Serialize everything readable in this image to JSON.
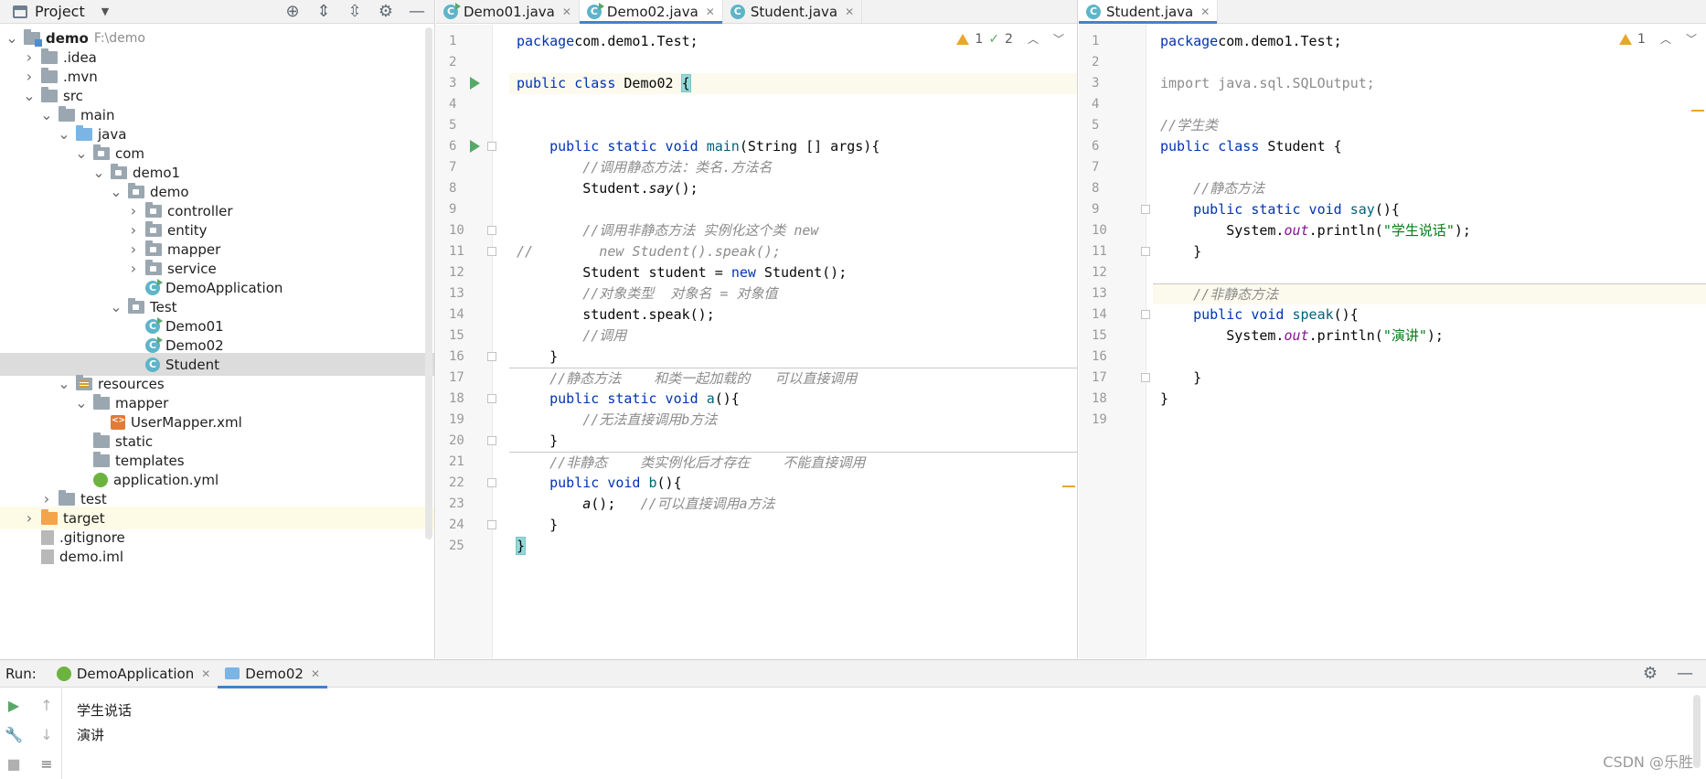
{
  "project": {
    "title": "Project",
    "tree": [
      {
        "label": "demo",
        "path": "F:\\demo",
        "depth": 0,
        "arrow": "v",
        "icon": "module-folder-icon",
        "bold": true
      },
      {
        "label": ".idea",
        "depth": 1,
        "arrow": ">",
        "icon": "folder-icon"
      },
      {
        "label": ".mvn",
        "depth": 1,
        "arrow": ">",
        "icon": "folder-icon"
      },
      {
        "label": "src",
        "depth": 1,
        "arrow": "v",
        "icon": "folder-icon"
      },
      {
        "label": "main",
        "depth": 2,
        "arrow": "v",
        "icon": "folder-icon"
      },
      {
        "label": "java",
        "depth": 3,
        "arrow": "v",
        "icon": "source-folder-icon"
      },
      {
        "label": "com",
        "depth": 4,
        "arrow": "v",
        "icon": "package-icon"
      },
      {
        "label": "demo1",
        "depth": 5,
        "arrow": "v",
        "icon": "package-icon"
      },
      {
        "label": "demo",
        "depth": 6,
        "arrow": "v",
        "icon": "package-icon"
      },
      {
        "label": "controller",
        "depth": 7,
        "arrow": ">",
        "icon": "package-icon"
      },
      {
        "label": "entity",
        "depth": 7,
        "arrow": ">",
        "icon": "package-icon"
      },
      {
        "label": "mapper",
        "depth": 7,
        "arrow": ">",
        "icon": "package-icon"
      },
      {
        "label": "service",
        "depth": 7,
        "arrow": ">",
        "icon": "package-icon"
      },
      {
        "label": "DemoApplication",
        "depth": 7,
        "arrow": "",
        "icon": "runnable-class-icon"
      },
      {
        "label": "Test",
        "depth": 6,
        "arrow": "v",
        "icon": "package-icon"
      },
      {
        "label": "Demo01",
        "depth": 7,
        "arrow": "",
        "icon": "runnable-class-icon"
      },
      {
        "label": "Demo02",
        "depth": 7,
        "arrow": "",
        "icon": "runnable-class-icon"
      },
      {
        "label": "Student",
        "depth": 7,
        "arrow": "",
        "icon": "class-icon",
        "selected": true
      },
      {
        "label": "resources",
        "depth": 3,
        "arrow": "v",
        "icon": "resources-folder-icon"
      },
      {
        "label": "mapper",
        "depth": 4,
        "arrow": "v",
        "icon": "folder-icon"
      },
      {
        "label": "UserMapper.xml",
        "depth": 5,
        "arrow": "",
        "icon": "xml-file-icon"
      },
      {
        "label": "static",
        "depth": 4,
        "arrow": "",
        "icon": "folder-icon"
      },
      {
        "label": "templates",
        "depth": 4,
        "arrow": "",
        "icon": "folder-icon"
      },
      {
        "label": "application.yml",
        "depth": 4,
        "arrow": "",
        "icon": "yml-file-icon"
      },
      {
        "label": "test",
        "depth": 2,
        "arrow": ">",
        "icon": "folder-icon"
      },
      {
        "label": "target",
        "depth": 1,
        "arrow": ">",
        "icon": "excluded-folder-icon",
        "highlight": true
      },
      {
        "label": ".gitignore",
        "depth": 1,
        "arrow": "",
        "icon": "file-icon"
      },
      {
        "label": "demo.iml",
        "depth": 1,
        "arrow": "",
        "icon": "file-icon"
      }
    ]
  },
  "left_editor": {
    "tabs": [
      {
        "label": "Demo01.java",
        "icon": "runnable-class-icon",
        "active": false
      },
      {
        "label": "Demo02.java",
        "icon": "runnable-class-icon",
        "active": true
      },
      {
        "label": "Student.java",
        "icon": "class-icon",
        "active": false
      }
    ],
    "inspections": {
      "warnings": "1",
      "checks": "2"
    },
    "lines": [
      [
        [
          "kw",
          "package"
        ],
        [
          "",
          "com.demo1.Test;"
        ]
      ],
      [],
      [
        [
          "kw",
          "public class"
        ],
        [
          "",
          " Demo02 "
        ],
        [
          "brace",
          "{"
        ]
      ],
      [],
      [],
      [
        [
          "",
          "    "
        ],
        [
          "kw",
          "public static void"
        ],
        [
          "",
          " "
        ],
        [
          "fn",
          "main"
        ],
        [
          "",
          "(String [] args){"
        ]
      ],
      [
        [
          "",
          "        "
        ],
        [
          "cm",
          "//调用静态方法：类名.方法名"
        ]
      ],
      [
        [
          "",
          "        Student."
        ],
        [
          "st",
          "say"
        ],
        [
          "",
          "();"
        ]
      ],
      [],
      [
        [
          "",
          "        "
        ],
        [
          "cm",
          "//调用非静态方法 实例化这个类 new"
        ]
      ],
      [
        [
          "cm",
          "//        new Student().speak();"
        ]
      ],
      [
        [
          "",
          "        Student student = "
        ],
        [
          "kw",
          "new"
        ],
        [
          "",
          " Student();"
        ]
      ],
      [
        [
          "",
          "        "
        ],
        [
          "cm",
          "//对象类型  对象名 = 对象值"
        ]
      ],
      [
        [
          "",
          "        student.speak();"
        ]
      ],
      [
        [
          "",
          "        "
        ],
        [
          "cm",
          "//调用"
        ]
      ],
      [
        [
          "",
          "    }"
        ]
      ],
      [
        [
          "",
          "    "
        ],
        [
          "cm",
          "//静态方法    和类一起加载的   可以直接调用"
        ]
      ],
      [
        [
          "",
          "    "
        ],
        [
          "kw",
          "public static void"
        ],
        [
          "",
          " "
        ],
        [
          "fn",
          "a"
        ],
        [
          "",
          "(){"
        ]
      ],
      [
        [
          "",
          "        "
        ],
        [
          "cm",
          "//无法直接调用b方法"
        ]
      ],
      [
        [
          "",
          "    }"
        ]
      ],
      [
        [
          "",
          "    "
        ],
        [
          "cm",
          "//非静态    类实例化后才存在    不能直接调用"
        ]
      ],
      [
        [
          "",
          "    "
        ],
        [
          "kw",
          "public void"
        ],
        [
          "",
          " "
        ],
        [
          "fn",
          "b"
        ],
        [
          "",
          "(){"
        ]
      ],
      [
        [
          "",
          "        "
        ],
        [
          "st",
          "a"
        ],
        [
          "",
          "();   "
        ],
        [
          "cm",
          "//可以直接调用a方法"
        ]
      ],
      [
        [
          "",
          "    }"
        ]
      ],
      [
        [
          "brace",
          "}"
        ]
      ]
    ]
  },
  "right_editor": {
    "tabs": [
      {
        "label": "Student.java",
        "icon": "class-icon",
        "active": true
      }
    ],
    "inspections": {
      "warnings": "1"
    },
    "lines": [
      [
        [
          "kw",
          "package"
        ],
        [
          "",
          "com.demo1.Test;"
        ]
      ],
      [],
      [
        [
          "gray",
          "import java.sql.SQLOutput;"
        ]
      ],
      [],
      [
        [
          "cm",
          "//学生类"
        ]
      ],
      [
        [
          "kw",
          "public class"
        ],
        [
          "",
          " Student {"
        ]
      ],
      [],
      [
        [
          "",
          "    "
        ],
        [
          "cm",
          "//静态方法"
        ]
      ],
      [
        [
          "",
          "    "
        ],
        [
          "kw",
          "public static void"
        ],
        [
          "",
          " "
        ],
        [
          "fn",
          "say"
        ],
        [
          "",
          "(){"
        ]
      ],
      [
        [
          "",
          "        System."
        ],
        [
          "fld",
          "out"
        ],
        [
          "",
          ".println("
        ],
        [
          "str",
          "\"学生说话\""
        ],
        [
          "",
          ");"
        ]
      ],
      [
        [
          "",
          "    }"
        ]
      ],
      [],
      [
        [
          "",
          "    "
        ],
        [
          "cm",
          "//非静态方法"
        ]
      ],
      [
        [
          "",
          "    "
        ],
        [
          "kw",
          "public void"
        ],
        [
          "",
          " "
        ],
        [
          "fn",
          "speak"
        ],
        [
          "",
          "(){"
        ]
      ],
      [
        [
          "",
          "        System."
        ],
        [
          "fld",
          "out"
        ],
        [
          "",
          ".println("
        ],
        [
          "str",
          "\"演讲\""
        ],
        [
          "",
          ");"
        ]
      ],
      [],
      [
        [
          "",
          "    }"
        ]
      ],
      [
        [
          "",
          "}"
        ]
      ],
      []
    ]
  },
  "run": {
    "label": "Run:",
    "tabs": [
      {
        "label": "DemoApplication",
        "icon": "spring-icon",
        "active": false
      },
      {
        "label": "Demo02",
        "icon": "run-config-icon",
        "active": true
      }
    ],
    "output": [
      "学生说话",
      "演讲"
    ]
  },
  "watermark": "CSDN @乐胜"
}
